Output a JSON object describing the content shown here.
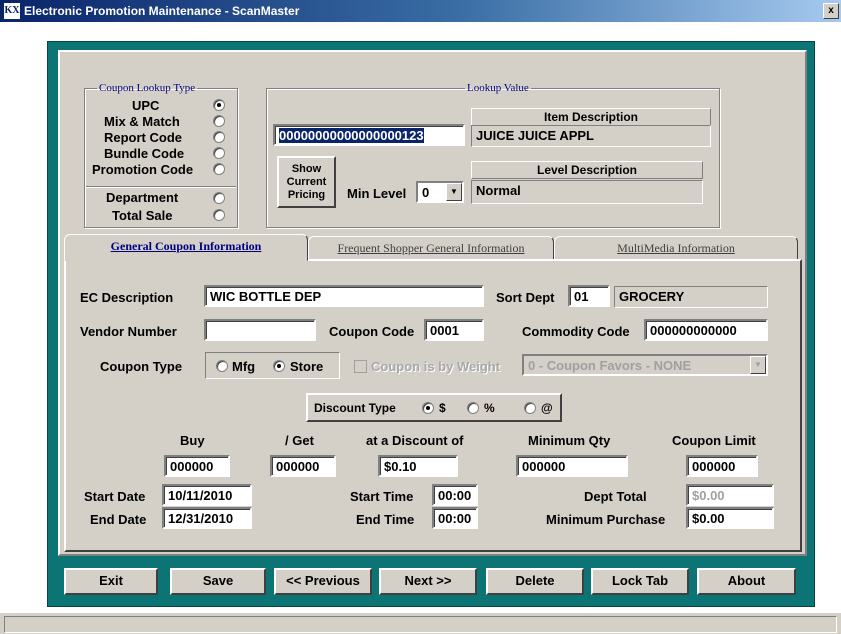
{
  "window": {
    "title": "Electronic Promotion Maintenance - ScanMaster",
    "app_icon_text": "KX",
    "close_glyph": "x"
  },
  "lookup_type": {
    "legend": "Coupon Lookup Type",
    "options": [
      {
        "label": "UPC",
        "selected": true
      },
      {
        "label": "Mix & Match",
        "selected": false
      },
      {
        "label": "Report Code",
        "selected": false
      },
      {
        "label": "Bundle Code",
        "selected": false
      },
      {
        "label": "Promotion Code",
        "selected": false
      },
      {
        "label": "Department",
        "selected": false
      },
      {
        "label": "Total Sale",
        "selected": false
      }
    ]
  },
  "lookup_value": {
    "legend": "Lookup Value",
    "value": "00000000000000000123",
    "item_description_header": "Item Description",
    "item_description": "JUICE JUICE APPL",
    "level_description_header": "Level Description",
    "level_description": "Normal",
    "show_pricing_label": "Show Current Pricing",
    "min_level_label": "Min Level",
    "min_level_value": "0"
  },
  "tabs": [
    {
      "label": "General Coupon Information",
      "active": true
    },
    {
      "label": "Frequent Shopper  General Information",
      "active": false
    },
    {
      "label": "MultiMedia Information",
      "active": false
    }
  ],
  "general": {
    "ec_description_label": "EC Description",
    "ec_description": "WIC BOTTLE DEP",
    "sort_dept_label": "Sort Dept",
    "sort_dept": "01",
    "sort_dept_name": "GROCERY",
    "vendor_number_label": "Vendor Number",
    "vendor_number": "",
    "coupon_code_label": "Coupon Code",
    "coupon_code": "0001",
    "commodity_code_label": "Commodity Code",
    "commodity_code": "000000000000",
    "coupon_type_label": "Coupon Type",
    "coupon_type_options": [
      {
        "label": "Mfg",
        "selected": false
      },
      {
        "label": "Store",
        "selected": true
      }
    ],
    "by_weight_label": "Coupon is by Weight",
    "favors_value": "0 - Coupon Favors - NONE",
    "discount_type_label": "Discount Type",
    "discount_type_options": [
      {
        "label": "$",
        "selected": true
      },
      {
        "label": "%",
        "selected": false
      },
      {
        "label": "@",
        "selected": false
      }
    ],
    "buy_label": "Buy",
    "buy": "000000",
    "get_label": "/ Get",
    "get": "000000",
    "discount_label": "at a Discount of",
    "discount": "$0.10",
    "min_qty_label": "Minimum Qty",
    "min_qty": "000000",
    "coupon_limit_label": "Coupon Limit",
    "coupon_limit": "000000",
    "start_date_label": "Start Date",
    "start_date": "10/11/2010",
    "end_date_label": "End Date",
    "end_date": "12/31/2010",
    "start_time_label": "Start Time",
    "start_time": "00:00",
    "end_time_label": "End Time",
    "end_time": "00:00",
    "dept_total_label": "Dept Total",
    "dept_total": "$0.00",
    "min_purchase_label": "Minimum Purchase",
    "min_purchase": "$0.00"
  },
  "buttons": {
    "exit": "Exit",
    "save": "Save",
    "previous": "<< Previous",
    "next": "Next >>",
    "delete": "Delete",
    "lock_tab": "Lock Tab",
    "about": "About"
  },
  "colors": {
    "frame": "#0d7475",
    "face": "#d4d0c8",
    "selection": "#0a246a",
    "legend_text": "#000080"
  }
}
